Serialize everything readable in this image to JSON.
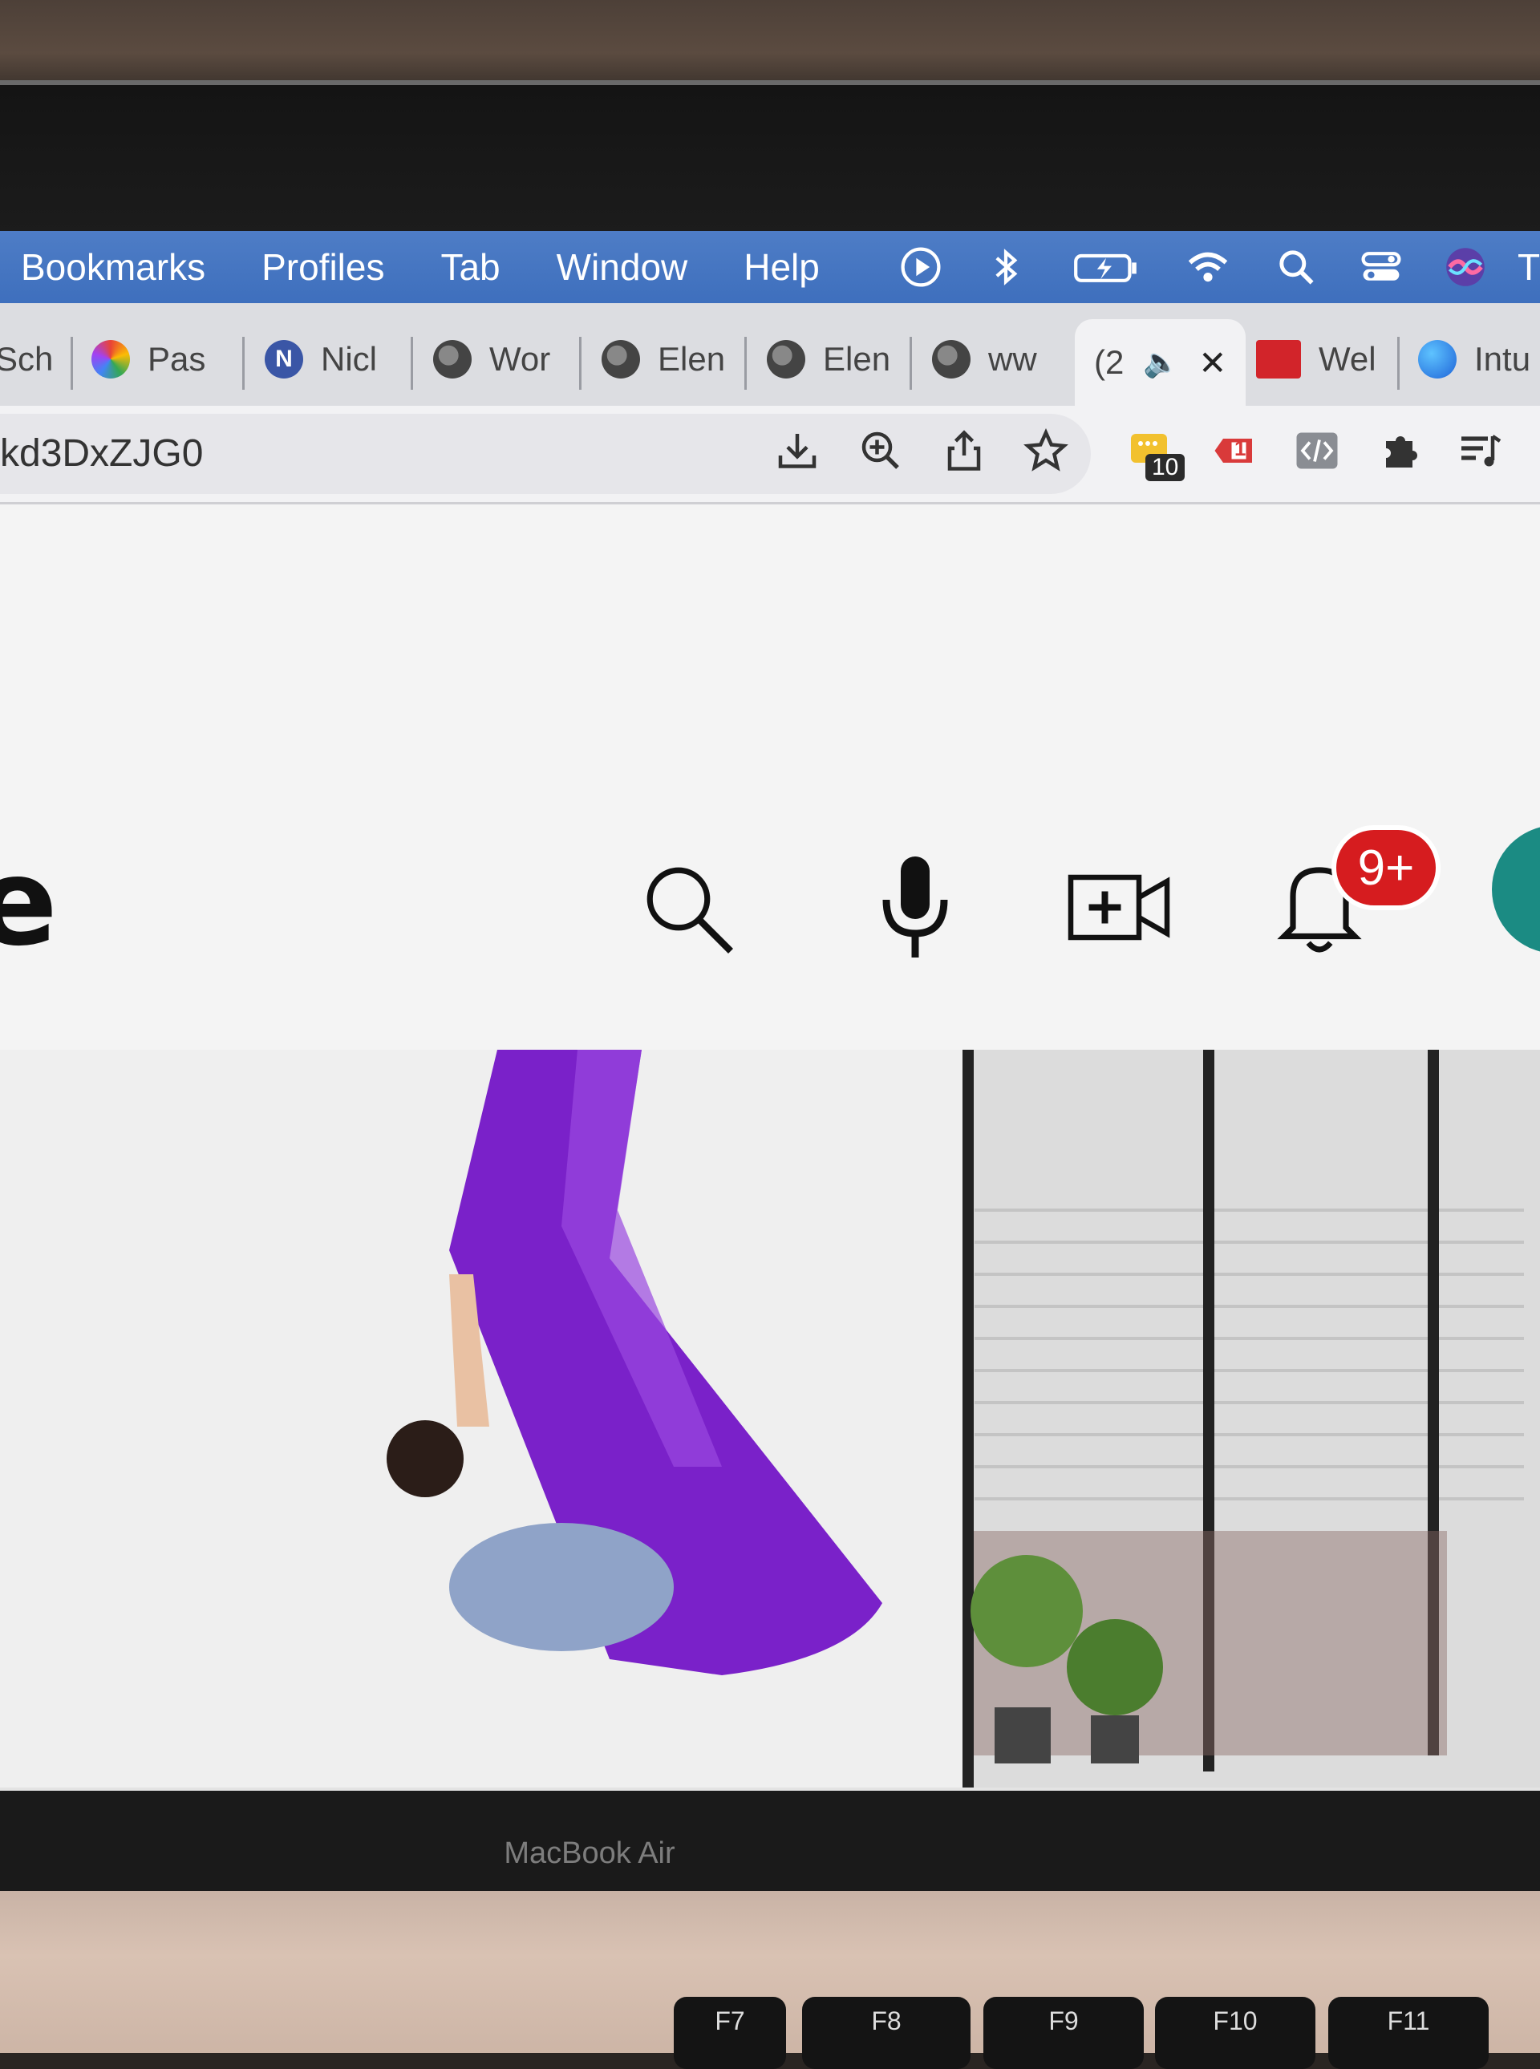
{
  "menubar": {
    "items": [
      "Bookmarks",
      "Profiles",
      "Tab",
      "Window",
      "Help"
    ],
    "status_icons": [
      "play-circle-icon",
      "bluetooth-icon",
      "battery-charging-icon",
      "wifi-icon",
      "spotlight-search-icon",
      "control-center-icon",
      "siri-icon"
    ],
    "truncated_tail": "T"
  },
  "tabs": [
    {
      "label": "Sch",
      "icon": "none"
    },
    {
      "label": "Pas",
      "icon": "colorful-flower-icon"
    },
    {
      "label": "Nicl",
      "icon": "n-logo-icon"
    },
    {
      "label": "Wor",
      "icon": "globe-icon"
    },
    {
      "label": "Elen",
      "icon": "globe-icon"
    },
    {
      "label": "Elen",
      "icon": "globe-icon"
    },
    {
      "label": "ww",
      "icon": "globe-icon"
    },
    {
      "label": "(2",
      "icon": "speaker-icon",
      "active": true,
      "close": "✕"
    },
    {
      "label": "Wel",
      "icon": "red-logo-icon"
    },
    {
      "label": "Intu",
      "icon": "blue-circle-icon"
    }
  ],
  "toolbar": {
    "url": "kd3DxZJG0",
    "extension_badge": "10",
    "icons": [
      "install-icon",
      "zoom-icon",
      "share-icon",
      "bookmark-star-icon",
      "extension-yellow-icon",
      "tag-icon",
      "code-icon",
      "puzzle-icon",
      "reading-list-icon"
    ],
    "tag_count": "1"
  },
  "page": {
    "logo_fragment": "e",
    "notification_badge": "9+",
    "header_icons": [
      "search-icon",
      "microphone-icon",
      "create-video-icon",
      "bell-icon"
    ]
  },
  "laptop": {
    "brand": "MacBook Air",
    "keys": [
      "F7",
      "F8",
      "F9",
      "F10",
      "F11"
    ]
  },
  "colors": {
    "menubar": "#4574c2",
    "badge_red": "#d61c1f",
    "hammock_purple": "#7a21c9",
    "avatar_teal": "#1b8b83"
  }
}
